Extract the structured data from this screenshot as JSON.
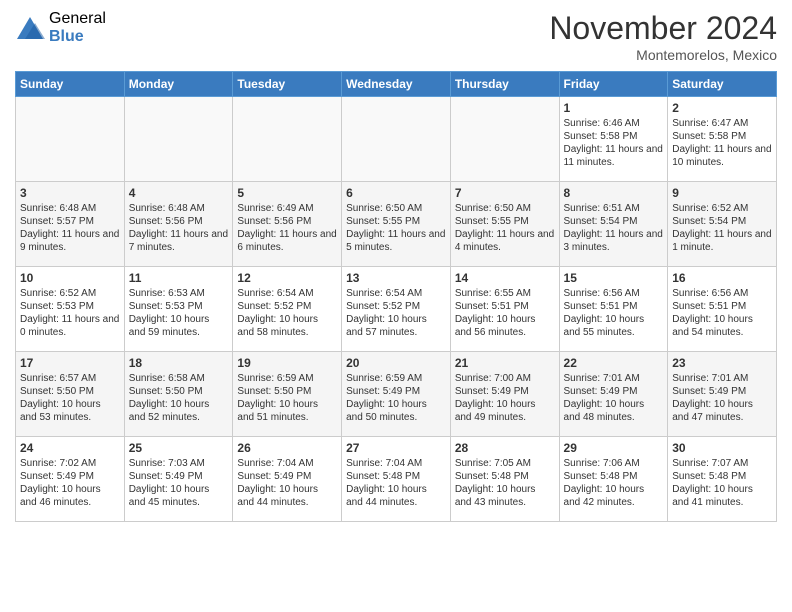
{
  "logo": {
    "general": "General",
    "blue": "Blue"
  },
  "title": "November 2024",
  "subtitle": "Montemorelos, Mexico",
  "days_of_week": [
    "Sunday",
    "Monday",
    "Tuesday",
    "Wednesday",
    "Thursday",
    "Friday",
    "Saturday"
  ],
  "weeks": [
    [
      {
        "day": "",
        "content": ""
      },
      {
        "day": "",
        "content": ""
      },
      {
        "day": "",
        "content": ""
      },
      {
        "day": "",
        "content": ""
      },
      {
        "day": "",
        "content": ""
      },
      {
        "day": "1",
        "content": "Sunrise: 6:46 AM\nSunset: 5:58 PM\nDaylight: 11 hours and 11 minutes."
      },
      {
        "day": "2",
        "content": "Sunrise: 6:47 AM\nSunset: 5:58 PM\nDaylight: 11 hours and 10 minutes."
      }
    ],
    [
      {
        "day": "3",
        "content": "Sunrise: 6:48 AM\nSunset: 5:57 PM\nDaylight: 11 hours and 9 minutes."
      },
      {
        "day": "4",
        "content": "Sunrise: 6:48 AM\nSunset: 5:56 PM\nDaylight: 11 hours and 7 minutes."
      },
      {
        "day": "5",
        "content": "Sunrise: 6:49 AM\nSunset: 5:56 PM\nDaylight: 11 hours and 6 minutes."
      },
      {
        "day": "6",
        "content": "Sunrise: 6:50 AM\nSunset: 5:55 PM\nDaylight: 11 hours and 5 minutes."
      },
      {
        "day": "7",
        "content": "Sunrise: 6:50 AM\nSunset: 5:55 PM\nDaylight: 11 hours and 4 minutes."
      },
      {
        "day": "8",
        "content": "Sunrise: 6:51 AM\nSunset: 5:54 PM\nDaylight: 11 hours and 3 minutes."
      },
      {
        "day": "9",
        "content": "Sunrise: 6:52 AM\nSunset: 5:54 PM\nDaylight: 11 hours and 1 minute."
      }
    ],
    [
      {
        "day": "10",
        "content": "Sunrise: 6:52 AM\nSunset: 5:53 PM\nDaylight: 11 hours and 0 minutes."
      },
      {
        "day": "11",
        "content": "Sunrise: 6:53 AM\nSunset: 5:53 PM\nDaylight: 10 hours and 59 minutes."
      },
      {
        "day": "12",
        "content": "Sunrise: 6:54 AM\nSunset: 5:52 PM\nDaylight: 10 hours and 58 minutes."
      },
      {
        "day": "13",
        "content": "Sunrise: 6:54 AM\nSunset: 5:52 PM\nDaylight: 10 hours and 57 minutes."
      },
      {
        "day": "14",
        "content": "Sunrise: 6:55 AM\nSunset: 5:51 PM\nDaylight: 10 hours and 56 minutes."
      },
      {
        "day": "15",
        "content": "Sunrise: 6:56 AM\nSunset: 5:51 PM\nDaylight: 10 hours and 55 minutes."
      },
      {
        "day": "16",
        "content": "Sunrise: 6:56 AM\nSunset: 5:51 PM\nDaylight: 10 hours and 54 minutes."
      }
    ],
    [
      {
        "day": "17",
        "content": "Sunrise: 6:57 AM\nSunset: 5:50 PM\nDaylight: 10 hours and 53 minutes."
      },
      {
        "day": "18",
        "content": "Sunrise: 6:58 AM\nSunset: 5:50 PM\nDaylight: 10 hours and 52 minutes."
      },
      {
        "day": "19",
        "content": "Sunrise: 6:59 AM\nSunset: 5:50 PM\nDaylight: 10 hours and 51 minutes."
      },
      {
        "day": "20",
        "content": "Sunrise: 6:59 AM\nSunset: 5:49 PM\nDaylight: 10 hours and 50 minutes."
      },
      {
        "day": "21",
        "content": "Sunrise: 7:00 AM\nSunset: 5:49 PM\nDaylight: 10 hours and 49 minutes."
      },
      {
        "day": "22",
        "content": "Sunrise: 7:01 AM\nSunset: 5:49 PM\nDaylight: 10 hours and 48 minutes."
      },
      {
        "day": "23",
        "content": "Sunrise: 7:01 AM\nSunset: 5:49 PM\nDaylight: 10 hours and 47 minutes."
      }
    ],
    [
      {
        "day": "24",
        "content": "Sunrise: 7:02 AM\nSunset: 5:49 PM\nDaylight: 10 hours and 46 minutes."
      },
      {
        "day": "25",
        "content": "Sunrise: 7:03 AM\nSunset: 5:49 PM\nDaylight: 10 hours and 45 minutes."
      },
      {
        "day": "26",
        "content": "Sunrise: 7:04 AM\nSunset: 5:49 PM\nDaylight: 10 hours and 44 minutes."
      },
      {
        "day": "27",
        "content": "Sunrise: 7:04 AM\nSunset: 5:48 PM\nDaylight: 10 hours and 44 minutes."
      },
      {
        "day": "28",
        "content": "Sunrise: 7:05 AM\nSunset: 5:48 PM\nDaylight: 10 hours and 43 minutes."
      },
      {
        "day": "29",
        "content": "Sunrise: 7:06 AM\nSunset: 5:48 PM\nDaylight: 10 hours and 42 minutes."
      },
      {
        "day": "30",
        "content": "Sunrise: 7:07 AM\nSunset: 5:48 PM\nDaylight: 10 hours and 41 minutes."
      }
    ]
  ]
}
